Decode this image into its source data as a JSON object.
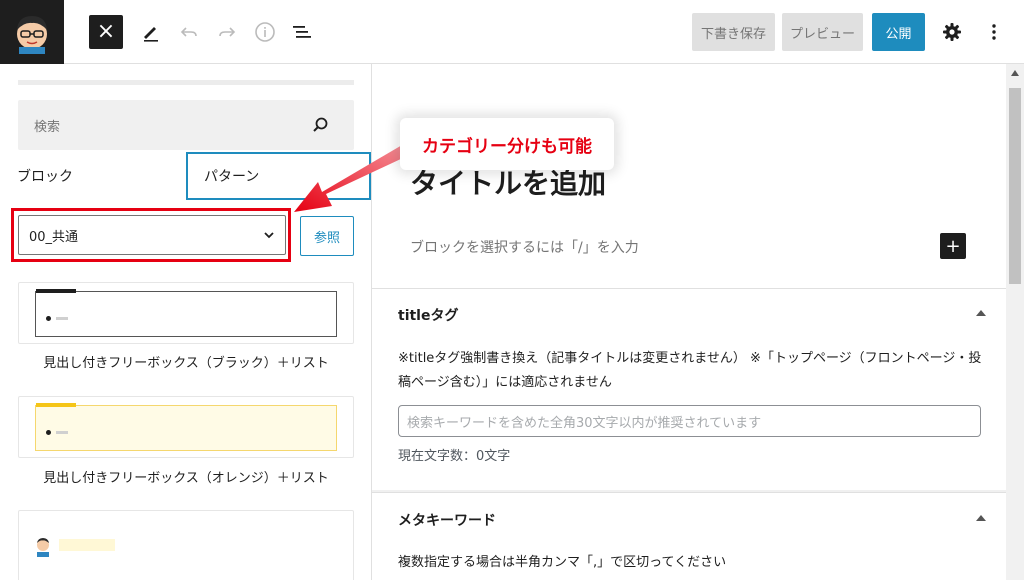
{
  "topbar": {
    "close_label": "×",
    "save_draft": "下書き保存",
    "preview": "プレビュー",
    "publish": "公開"
  },
  "inserter": {
    "search_placeholder": "検索",
    "tabs": [
      "ブロック",
      "パターン"
    ],
    "category_selected": "00_共通",
    "browse": "参照",
    "patterns": [
      {
        "label": "見出し付きフリーボックス（ブラック）＋リスト"
      },
      {
        "label": "見出し付きフリーボックス（オレンジ）＋リスト"
      }
    ]
  },
  "editor": {
    "title_placeholder": "タイトルを追加",
    "block_placeholder": "ブロックを選択するには「/」を入力",
    "add_block": "+"
  },
  "meta": {
    "title_tag": {
      "heading": "titleタグ",
      "description": "※titleタグ強制書き換え（記事タイトルは変更されません） ※「トップページ（フロントページ・投稿ページ含む）」には適応されません",
      "input_placeholder": "検索キーワードを含めた全角30文字以内が推奨されています",
      "count": "現在文字数：0文字"
    },
    "meta_keywords": {
      "heading": "メタキーワード",
      "description": "複数指定する場合は半角カンマ「,」で区切ってください"
    }
  },
  "annotation": {
    "text": "カテゴリー分けも可能"
  },
  "colors": {
    "accent": "#1e8cbe",
    "highlight": "#e60012"
  }
}
